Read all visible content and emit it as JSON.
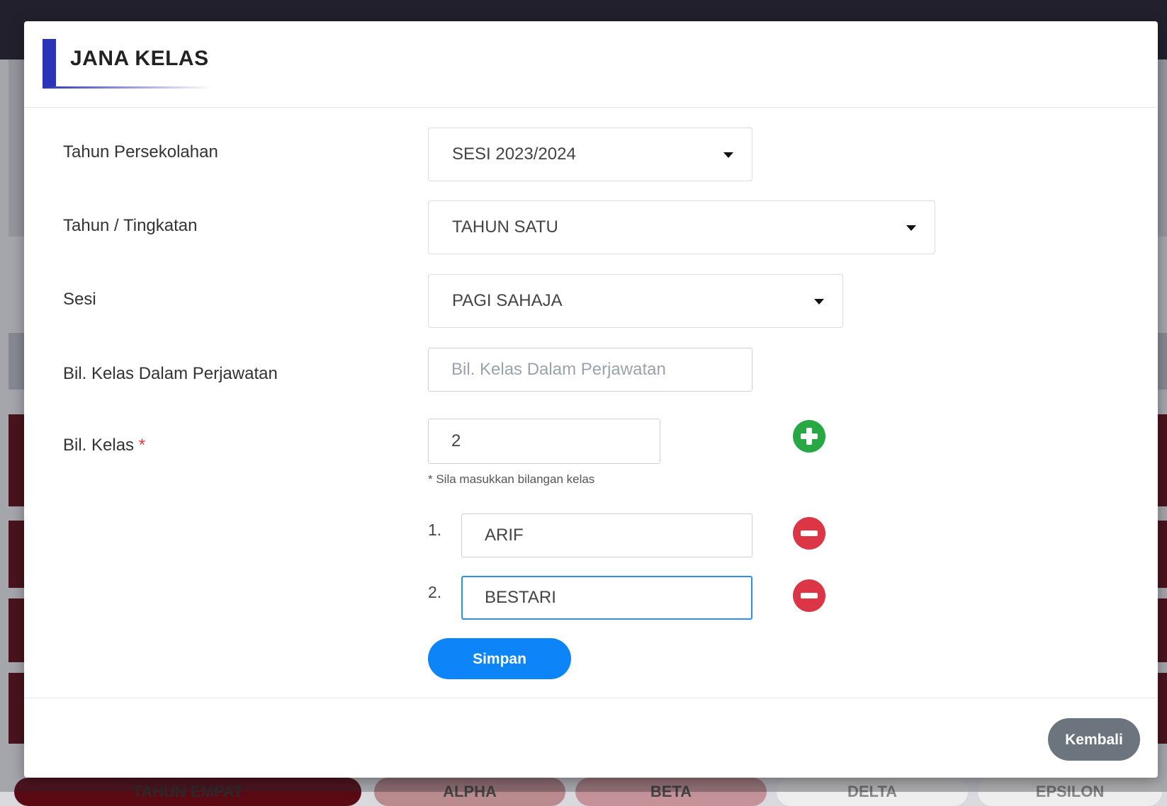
{
  "background": {
    "tabs": [
      "TAHUN EMPAT",
      "ALPHA",
      "BETA",
      "DELTA",
      "EPSILON"
    ]
  },
  "modal": {
    "title": "JANA KELAS",
    "fields": {
      "tahun_persekolahan": {
        "label": "Tahun Persekolahan",
        "value": "SESI 2023/2024"
      },
      "tahun_tingkatan": {
        "label": "Tahun / Tingkatan",
        "value": "TAHUN SATU"
      },
      "sesi": {
        "label": "Sesi",
        "value": "PAGI SAHAJA"
      },
      "bil_kelas_perjawatan": {
        "label": "Bil. Kelas Dalam Perjawatan",
        "value": "",
        "placeholder": "Bil. Kelas Dalam Perjawatan"
      },
      "bil_kelas": {
        "label": "Bil. Kelas",
        "required_mark": "*",
        "value": "2",
        "hint": "* Sila masukkan bilangan kelas"
      }
    },
    "classes": [
      {
        "index": "1.",
        "name": "ARIF"
      },
      {
        "index": "2.",
        "name": "BESTARI"
      }
    ],
    "buttons": {
      "save": "Simpan",
      "back": "Kembali"
    },
    "icons": {
      "add": "plus-circle-icon",
      "remove": "minus-circle-icon"
    }
  },
  "colors": {
    "primary": "#0d84f8",
    "add": "#27a844",
    "remove": "#dc3545",
    "secondary": "#6c757d",
    "title_accent": "#2b34b9"
  }
}
